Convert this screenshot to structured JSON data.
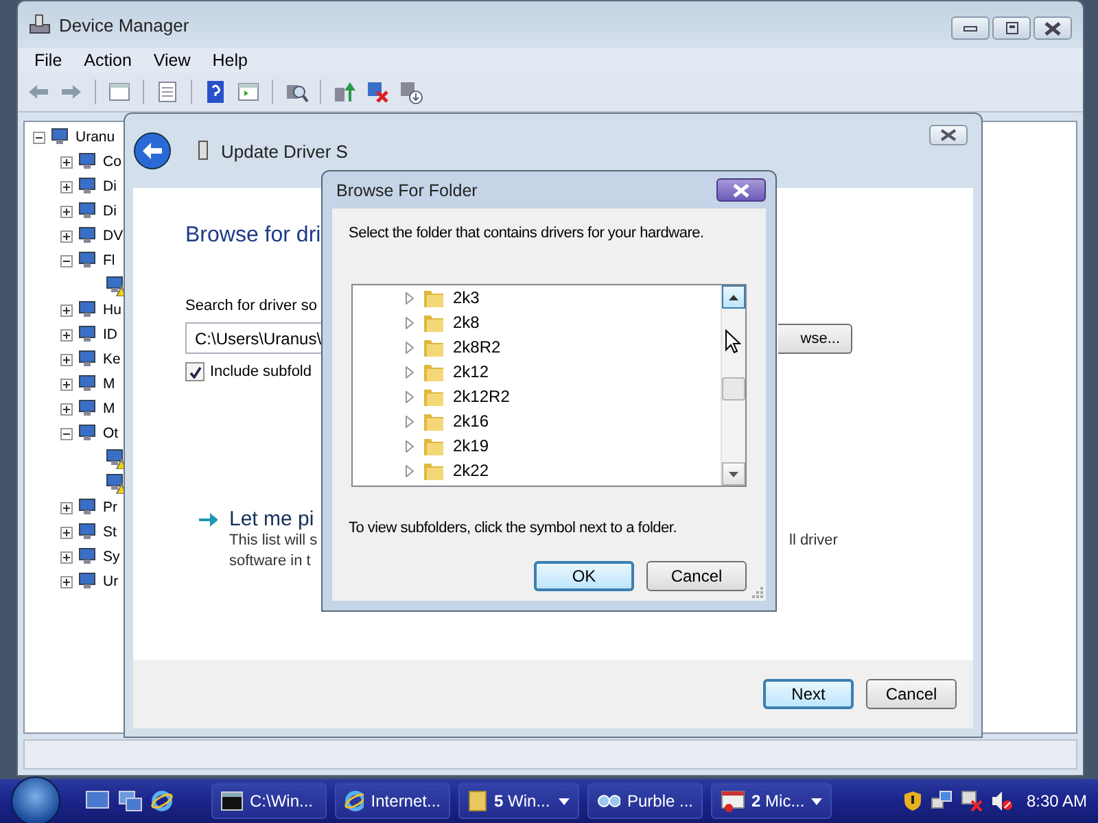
{
  "device_manager": {
    "title": "Device Manager",
    "menu": [
      "File",
      "Action",
      "View",
      "Help"
    ],
    "tree": {
      "label": "Uranu",
      "expanded": true,
      "children": [
        {
          "label": "Co",
          "expanded": false
        },
        {
          "label": "Di",
          "expanded": false
        },
        {
          "label": "Di",
          "expanded": false
        },
        {
          "label": "DV",
          "expanded": false
        },
        {
          "label": "Fl",
          "expanded": true,
          "children": [
            {
              "warning": true
            }
          ]
        },
        {
          "label": "Hu",
          "expanded": false
        },
        {
          "label": "ID",
          "expanded": false
        },
        {
          "label": "Ke",
          "expanded": false
        },
        {
          "label": "M",
          "expanded": false
        },
        {
          "label": "M",
          "expanded": false
        },
        {
          "label": "Ot",
          "expanded": true,
          "children": [
            {
              "warning": true
            },
            {
              "warning": true
            }
          ]
        },
        {
          "label": "Pr",
          "expanded": false
        },
        {
          "label": "St",
          "expanded": false
        },
        {
          "label": "Sy",
          "expanded": false
        },
        {
          "label": "Ur",
          "expanded": false
        }
      ]
    }
  },
  "wizard": {
    "title": "Update Driver S",
    "heading": "Browse for dri",
    "search_label": "Search for driver so",
    "path_field": {
      "value": "C:\\Users\\Uranus\\"
    },
    "include_subfolders": {
      "label": "Include subfold",
      "checked": true
    },
    "browse_button": "wse...",
    "let_me_pick": {
      "title": "Let me pi",
      "lines": [
        "This list will s",
        "software in t"
      ],
      "line_end": "ll driver"
    },
    "buttons": [
      {
        "label": "Next",
        "default": true
      },
      {
        "label": "Cancel",
        "default": false
      }
    ]
  },
  "browse_dialog": {
    "title": "Browse For Folder",
    "instruction": "Select the folder that contains drivers for your hardware.",
    "folders": [
      {
        "label": "2k3",
        "expanded": false
      },
      {
        "label": "2k8",
        "expanded": false
      },
      {
        "label": "2k8R2",
        "expanded": false
      },
      {
        "label": "2k12",
        "expanded": false
      },
      {
        "label": "2k12R2",
        "expanded": false
      },
      {
        "label": "2k16",
        "expanded": false
      },
      {
        "label": "2k19",
        "expanded": false
      },
      {
        "label": "2k22",
        "expanded": false
      }
    ],
    "hint": "To view subfolders, click the symbol next to a folder.",
    "buttons": [
      {
        "label": "OK",
        "default": true
      },
      {
        "label": "Cancel",
        "default": false
      }
    ]
  },
  "taskbar": {
    "tasks": [
      {
        "label": "C:\\Win...",
        "kind": "console",
        "grouped": false
      },
      {
        "label": "Internet...",
        "kind": "browser",
        "grouped": false
      },
      {
        "count": "5",
        "label": "Win...",
        "kind": "folder",
        "grouped": true
      },
      {
        "label": "Purble ...",
        "kind": "game",
        "grouped": false
      },
      {
        "count": "2",
        "label": "Mic...",
        "kind": "office",
        "grouped": true
      }
    ],
    "clock": "8:30 AM"
  }
}
